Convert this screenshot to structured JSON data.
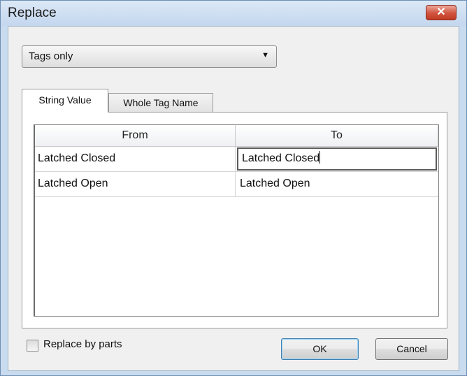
{
  "window": {
    "title": "Replace",
    "close_label": "✕"
  },
  "scope": {
    "selected": "Tags only",
    "arrow": "▼"
  },
  "tabs": [
    {
      "label": "String Value",
      "active": true
    },
    {
      "label": "Whole Tag Name",
      "active": false
    }
  ],
  "grid": {
    "columns": [
      "From",
      "To"
    ],
    "rows": [
      {
        "from": "Latched Closed",
        "to": "Latched Closed",
        "editing": true
      },
      {
        "from": "Latched Open",
        "to": "Latched Open",
        "editing": false
      }
    ]
  },
  "options": {
    "replace_by_parts_label": "Replace by parts",
    "replace_by_parts_checked": false
  },
  "buttons": {
    "ok": "OK",
    "cancel": "Cancel"
  }
}
